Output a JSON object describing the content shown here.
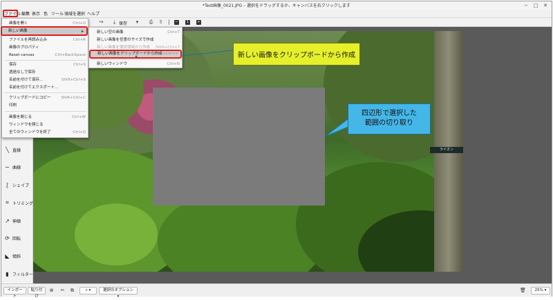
{
  "window": {
    "title": "*Test画像_0021.JPG – 選択をドラッグするか、キャンバスを右クリックします",
    "controls": [
      "−",
      "□",
      "✕"
    ]
  },
  "menubar": {
    "items": [
      "ファイル",
      "編集",
      "表示",
      "色",
      "ツール",
      "領域を選択",
      "ヘルプ"
    ]
  },
  "toolbar": {
    "save_label": "保存"
  },
  "file_menu": {
    "items": [
      {
        "label": "画像を開く",
        "shortcut": "Ctrl+O"
      },
      {
        "label": "新しい画像",
        "shortcut": "▸"
      },
      {
        "label": "ファイルを再読み込み",
        "shortcut": "Ctrl+R"
      },
      {
        "label": "画像のプロパティ",
        "shortcut": ""
      },
      {
        "label": "Reset canvas",
        "shortcut": "Ctrl+BackSpace"
      },
      {
        "label": "保存",
        "shortcut": "Ctrl+S"
      },
      {
        "label": "透過なしで保存",
        "shortcut": ""
      },
      {
        "label": "名前を付けて保存…",
        "shortcut": "Shift+Ctrl+S"
      },
      {
        "label": "名前を付けてエクスポート…",
        "shortcut": ""
      },
      {
        "label": "クリップボードにコピー",
        "shortcut": "Shift+Ctrl+C"
      },
      {
        "label": "印刷",
        "shortcut": ""
      },
      {
        "label": "画像を閉じる",
        "shortcut": "Ctrl+W"
      },
      {
        "label": "ウィンドウを閉じる",
        "shortcut": ""
      },
      {
        "label": "全てのウィンドウを終了",
        "shortcut": "Ctrl+Q"
      }
    ]
  },
  "sub_menu": {
    "items": [
      {
        "label": "新しい空の画像",
        "shortcut": "Ctrl+T"
      },
      {
        "label": "新しい画像を任意のサイズで作成",
        "shortcut": ""
      },
      {
        "label": "新しい画像を選択領域から作成",
        "shortcut": "Shift+Ctrl+T"
      },
      {
        "label": "新しい画像をクリップボードから作成",
        "shortcut": "Shift+Ctrl+V"
      },
      {
        "label": "新しいウィンドウ",
        "shortcut": "Ctrl+N"
      }
    ]
  },
  "sidebar": {
    "items": [
      "直線",
      "曲線",
      "シェイプ",
      "トリミング",
      "伸縮",
      "回転",
      "傾斜",
      "フィルター"
    ]
  },
  "bottombar": {
    "import_label": "インポート",
    "paste_label": "貼り付け",
    "selection_options_label": "選択のオプション",
    "zoom": "25%"
  },
  "callouts": {
    "clipboard": "新しい画像をクリップボードから作成",
    "rect_line1": "四辺形で選択した",
    "rect_line2": "範囲の切り取り"
  },
  "photo_sign_text": "ライオン"
}
